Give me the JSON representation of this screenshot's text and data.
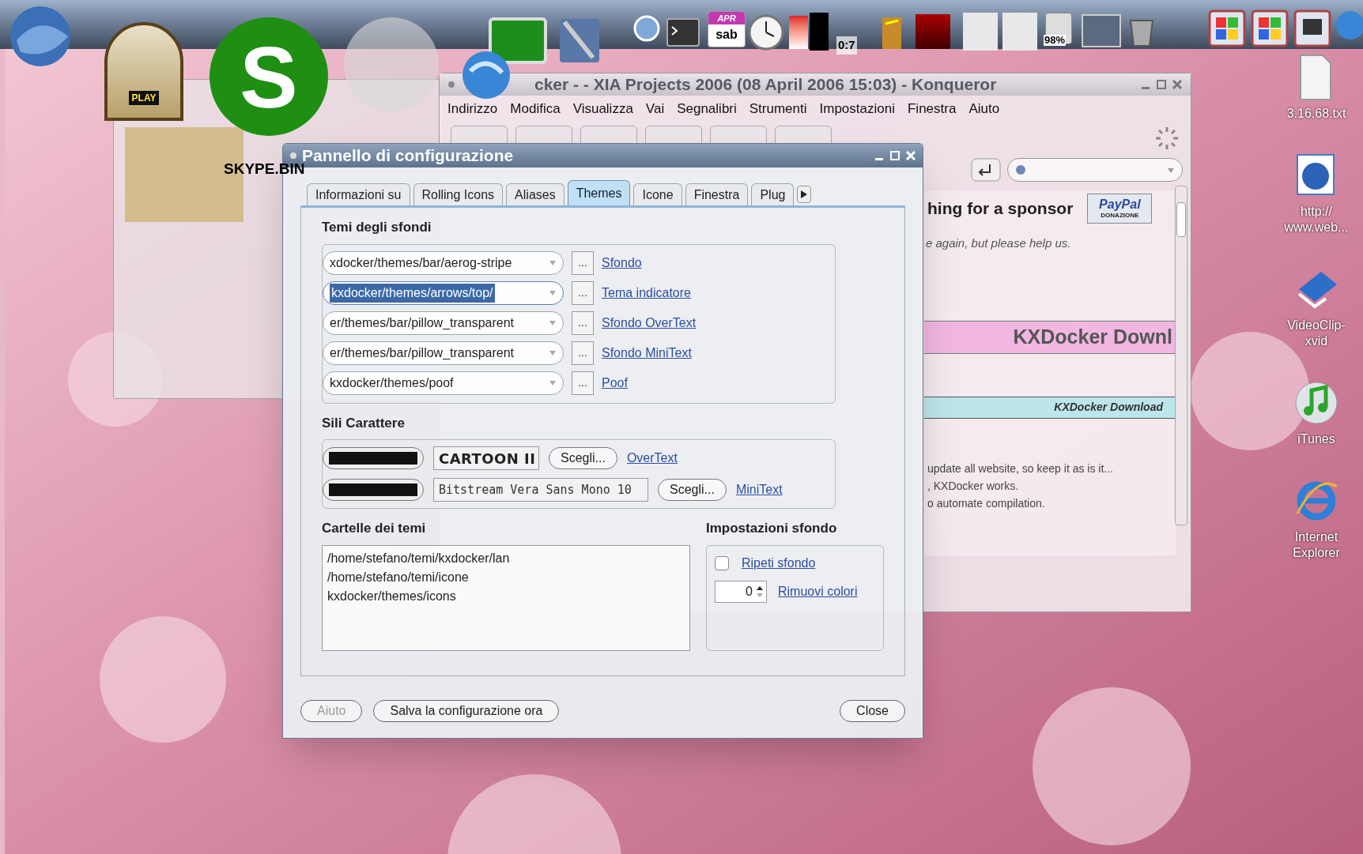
{
  "dock": {
    "jukebox_label": "PLAY",
    "skype_letter": "S",
    "calendar_month": "APR",
    "calendar_day": "sab",
    "meter_reading": "0:7",
    "battery_reading": "98%"
  },
  "desktop": {
    "skype_label": "SKYPE.BIN",
    "icons": [
      {
        "kind": "text-file",
        "label": "3.16.68.txt"
      },
      {
        "kind": "web-link",
        "label": "http://\nwww.web..."
      },
      {
        "kind": "video",
        "label": "VideoClip-\nxvid"
      },
      {
        "kind": "music",
        "label": "iTunes"
      },
      {
        "kind": "browser",
        "label": "Internet\nExplorer"
      }
    ]
  },
  "konqueror": {
    "title": "cker - - XIA Projects 2006 (08 April 2006 15:03) - Konqueror",
    "menu": [
      "Indirizzo",
      "Modifica",
      "Visualizza",
      "Vai",
      "Segnalibri",
      "Strumenti",
      "Impostazioni",
      "Finestra",
      "Aiuto"
    ],
    "page": {
      "headline": "hing for a sponsor",
      "paypal": "PayPal",
      "paypal_caption": "DONAZIONE",
      "note": "e again, but please help us.",
      "banner": "KXDocker Downl",
      "subbanner": "KXDocker Download",
      "lines": [
        "update all website, so keep it as is it...",
        ", KXDocker works.",
        "o automate compilation."
      ]
    }
  },
  "dialog": {
    "title": "Pannello di configurazione",
    "tabs": [
      {
        "label": "Informazioni su",
        "selected": false
      },
      {
        "label": "Rolling Icons",
        "selected": false
      },
      {
        "label": "Aliases",
        "selected": false
      },
      {
        "label": "Themes",
        "selected": true
      },
      {
        "label": "Icone",
        "selected": false
      },
      {
        "label": "Finestra",
        "selected": false
      },
      {
        "label": "Plug",
        "selected": false
      }
    ],
    "background_themes": {
      "heading": "Temi degli sfondi",
      "rows": [
        {
          "value": "xdocker/themes/bar/aerog-stripe",
          "highlighted": false,
          "browse": "...",
          "link": "Sfondo"
        },
        {
          "value": "kxdocker/themes/arrows/top/",
          "highlighted": true,
          "browse": "...",
          "link": "Tema indicatore"
        },
        {
          "value": "er/themes/bar/pillow_transparent",
          "highlighted": false,
          "browse": "...",
          "link": "Sfondo OverText"
        },
        {
          "value": "er/themes/bar/pillow_transparent",
          "highlighted": false,
          "browse": "...",
          "link": "Sfondo MiniText"
        },
        {
          "value": "kxdocker/themes/poof",
          "highlighted": false,
          "browse": "...",
          "link": "Poof"
        }
      ]
    },
    "font_styles": {
      "heading": "Sili Carattere",
      "rows": [
        {
          "color": "#111111",
          "kind": "display",
          "font": "CARTOON II",
          "button": "Scegli...",
          "link": "OverText"
        },
        {
          "color": "#111111",
          "kind": "mono",
          "font": "Bitstream Vera Sans Mono 10",
          "button": "Scegli...",
          "link": "MiniText"
        }
      ]
    },
    "theme_folders": {
      "heading": "Cartelle dei temi",
      "items": [
        "/home/stefano/temi/kxdocker/lan",
        "/home/stefano/temi/icone",
        "kxdocker/themes/icons"
      ]
    },
    "background_settings": {
      "heading": "Impostazioni sfondo",
      "repeat": {
        "label": "Ripeti sfondo",
        "checked": false
      },
      "colors": {
        "value": "0",
        "label": "Rimuovi colori"
      }
    },
    "buttons": [
      {
        "label": "Aiuto",
        "disabled": true
      },
      {
        "label": "Salva la configurazione ora",
        "disabled": false
      },
      {
        "label": "Close",
        "disabled": false
      }
    ]
  }
}
